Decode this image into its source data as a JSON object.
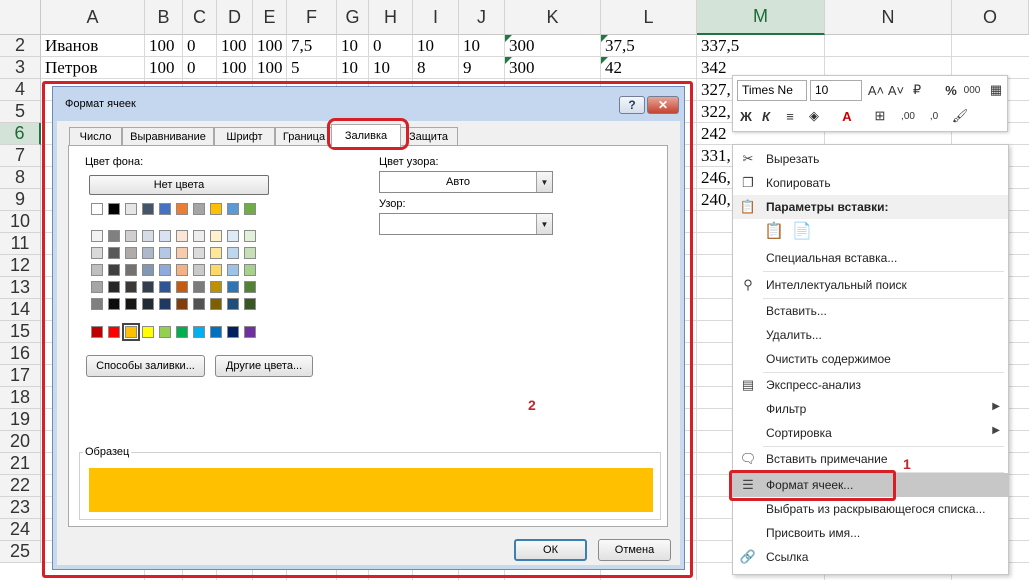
{
  "columns": [
    "A",
    "B",
    "C",
    "D",
    "E",
    "F",
    "G",
    "H",
    "I",
    "J",
    "K",
    "L",
    "M",
    "N",
    "O"
  ],
  "selected_column": "M",
  "rows": [
    "2",
    "3",
    "4",
    "5",
    "6",
    "7",
    "8",
    "9",
    "10",
    "11",
    "12",
    "13",
    "14",
    "15",
    "16",
    "17",
    "18",
    "19",
    "20",
    "21",
    "22",
    "23",
    "24",
    "25"
  ],
  "selected_row": "6",
  "sheet_rows": [
    {
      "A": "Иванов",
      "B": "100",
      "C": "0",
      "D": "100",
      "E": "100",
      "F": "7,5",
      "G": "10",
      "H": "0",
      "I": "10",
      "J": "10",
      "K": "300",
      "L": "37,5",
      "M": "337,5"
    },
    {
      "A": "Петров",
      "B": "100",
      "C": "0",
      "D": "100",
      "E": "100",
      "F": "5",
      "G": "10",
      "H": "10",
      "I": "8",
      "J": "9",
      "K": "300",
      "L": "42",
      "M": "342"
    }
  ],
  "m_partial": [
    "327,",
    "322,",
    "242",
    "331,",
    "246,",
    "240,"
  ],
  "dialog": {
    "title": "Формат ячеек",
    "tabs": [
      "Число",
      "Выравнивание",
      "Шрифт",
      "Граница",
      "Заливка",
      "Защита"
    ],
    "active_tab": "Заливка",
    "bg_color_label": "Цвет фона:",
    "no_color_label": "Нет цвета",
    "pattern_color_label": "Цвет узора:",
    "pattern_color_value": "Авто",
    "pattern_label": "Узор:",
    "pattern_value": "",
    "fill_effects_label": "Способы заливки...",
    "more_colors_label": "Другие цвета...",
    "sample_label": "Образец",
    "sample_color": "#ffc000",
    "ok_label": "ОК",
    "cancel_label": "Отмена",
    "palette_theme_row": [
      "#ffffff",
      "#000000",
      "#e7e6e6",
      "#44546a",
      "#4472c4",
      "#ed7d31",
      "#a5a5a5",
      "#ffc000",
      "#5b9bd5",
      "#70ad47"
    ],
    "palette_tints": [
      [
        "#f2f2f2",
        "#808080",
        "#d0cece",
        "#d6dce5",
        "#d9e2f3",
        "#fbe5d6",
        "#ededed",
        "#fff2cc",
        "#deebf7",
        "#e2f0d9"
      ],
      [
        "#d9d9d9",
        "#595959",
        "#afabab",
        "#adb9ca",
        "#b4c7e7",
        "#f8cbad",
        "#dbdbdb",
        "#ffe699",
        "#bdd7ee",
        "#c5e0b4"
      ],
      [
        "#bfbfbf",
        "#404040",
        "#767171",
        "#8497b0",
        "#8faadc",
        "#f4b183",
        "#c9c9c9",
        "#ffd966",
        "#9dc3e6",
        "#a9d18e"
      ],
      [
        "#a6a6a6",
        "#262626",
        "#3b3838",
        "#333f50",
        "#2f5597",
        "#c55a11",
        "#7b7b7b",
        "#bf9000",
        "#2e75b6",
        "#548235"
      ],
      [
        "#808080",
        "#0d0d0d",
        "#171515",
        "#222a35",
        "#1f3864",
        "#833c0b",
        "#525252",
        "#7f6000",
        "#1f4e79",
        "#385723"
      ]
    ],
    "palette_standard": [
      "#c00000",
      "#ff0000",
      "#ffc000",
      "#ffff00",
      "#92d050",
      "#00b050",
      "#00b0f0",
      "#0070c0",
      "#002060",
      "#7030a0"
    ],
    "selected_standard_index": 2
  },
  "minitoolbar": {
    "font_name": "Times Ne",
    "font_size": "10"
  },
  "menu": {
    "items": [
      {
        "label": "Вырезать",
        "icon": "scissors-icon",
        "glyph": "✂"
      },
      {
        "label": "Копировать",
        "icon": "copy-icon",
        "glyph": "❐"
      },
      {
        "label": "Параметры вставки:",
        "icon": "paste-icon",
        "glyph": "📋",
        "section": true
      },
      {
        "label": "",
        "icon": "paste-options-icon",
        "glyph": ""
      },
      {
        "label": "Специальная вставка...",
        "icon": "",
        "glyph": ""
      },
      {
        "label": "Интеллектуальный поиск",
        "icon": "smart-lookup-icon",
        "glyph": "⚲"
      },
      {
        "label": "Вставить...",
        "icon": "",
        "glyph": ""
      },
      {
        "label": "Удалить...",
        "icon": "",
        "glyph": ""
      },
      {
        "label": "Очистить содержимое",
        "icon": "",
        "glyph": ""
      },
      {
        "label": "Экспресс-анализ",
        "icon": "quick-analysis-icon",
        "glyph": "▤"
      },
      {
        "label": "Фильтр",
        "icon": "",
        "glyph": "",
        "submenu": true
      },
      {
        "label": "Сортировка",
        "icon": "",
        "glyph": "",
        "submenu": true
      },
      {
        "label": "Вставить примечание",
        "icon": "comment-icon",
        "glyph": "🗨"
      },
      {
        "label": "Формат ячеек...",
        "icon": "format-cells-icon",
        "glyph": "☰",
        "highlight": true
      },
      {
        "label": "Выбрать из раскрывающегося списка...",
        "icon": "",
        "glyph": ""
      },
      {
        "label": "Присвоить имя...",
        "icon": "",
        "glyph": ""
      },
      {
        "label": "Ссылка",
        "icon": "hyperlink-icon",
        "glyph": "🔗"
      }
    ]
  },
  "annotations": {
    "one": "1",
    "two": "2"
  }
}
